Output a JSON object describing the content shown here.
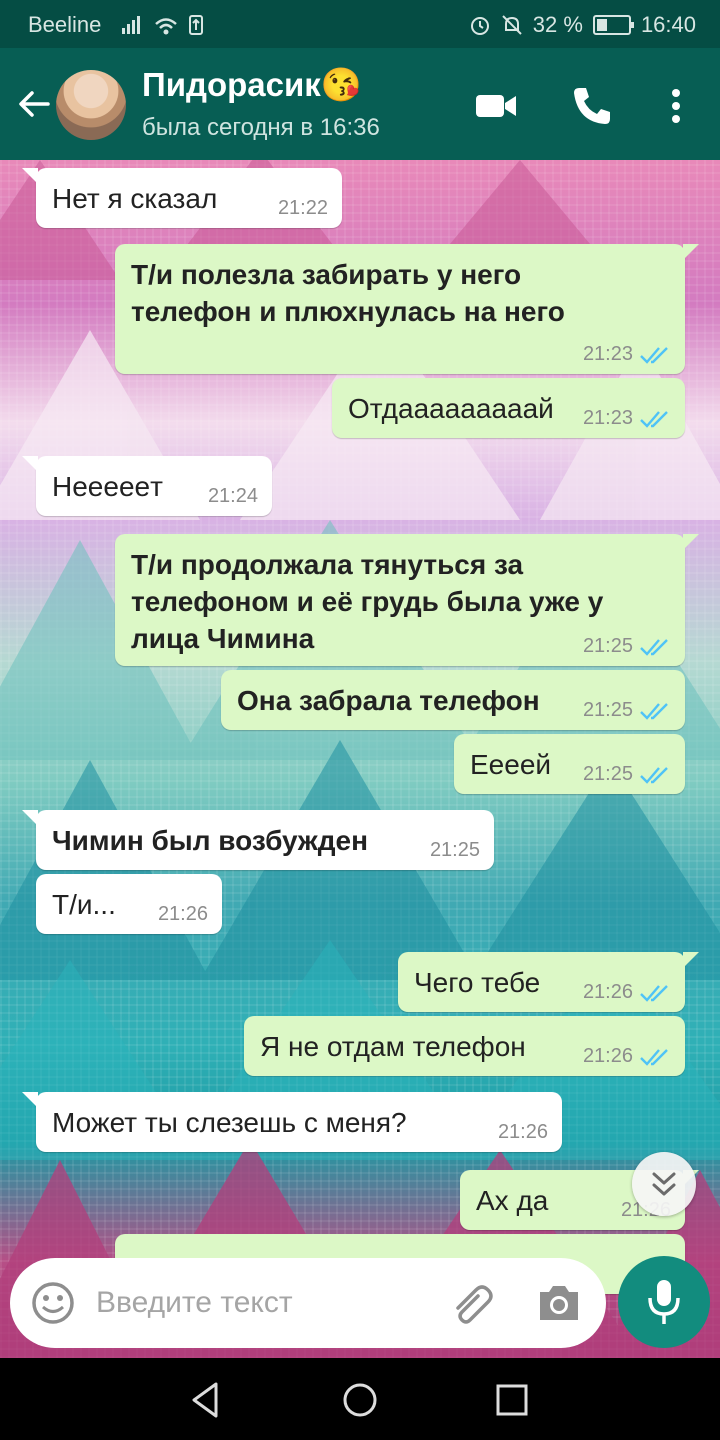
{
  "status_bar": {
    "carrier": "Beeline",
    "battery": "32 %",
    "battery_level": 0.32,
    "time": "16:40"
  },
  "header": {
    "contact_name": "Пидорасик😘",
    "last_seen": "была сегодня в 16:36",
    "icons": [
      "back-arrow-icon",
      "video-call-icon",
      "phone-icon",
      "more-vert-icon"
    ]
  },
  "messages": [
    {
      "dir": "in",
      "text": "Нет я сказал",
      "time": "21:22",
      "bold": false
    },
    {
      "dir": "out",
      "text": "Т/и полезла забирать у него телефон и плюхнулась на него",
      "time": "21:23",
      "bold": true
    },
    {
      "dir": "out",
      "text": "Отдааааааааай",
      "time": "21:23",
      "bold": false
    },
    {
      "dir": "in",
      "text": "Неееeeт",
      "time": "21:24",
      "bold": false
    },
    {
      "dir": "out",
      "text": "Т/и продолжала тянуться за телефоном и её грудь была уже у лица Чимина",
      "time": "21:25",
      "bold": true
    },
    {
      "dir": "out",
      "text": "Она забрала телефон",
      "time": "21:25",
      "bold": true
    },
    {
      "dir": "out",
      "text": "Еееей",
      "time": "21:25",
      "bold": false
    },
    {
      "dir": "in",
      "text": "Чимин был возбужден",
      "time": "21:25",
      "bold": true
    },
    {
      "dir": "in",
      "text": "Т/и...",
      "time": "21:26",
      "bold": false
    },
    {
      "dir": "out",
      "text": "Чего тебе",
      "time": "21:26",
      "bold": false
    },
    {
      "dir": "out",
      "text": "Я не отдам телефон",
      "time": "21:26",
      "bold": false
    },
    {
      "dir": "in",
      "text": "Может ты слезешь с меня?",
      "time": "21:26",
      "bold": false
    },
    {
      "dir": "out",
      "text": "Ах да",
      "time": "21:26",
      "bold": false
    }
  ],
  "composer": {
    "placeholder": "Введите текст"
  },
  "colors": {
    "header": "#075e54",
    "status_bar": "#054d44",
    "outgoing_bubble": "#dcf8c6",
    "incoming_bubble": "#ffffff",
    "read_ticks": "#4fc3f7",
    "mic_button": "#128c7e"
  }
}
